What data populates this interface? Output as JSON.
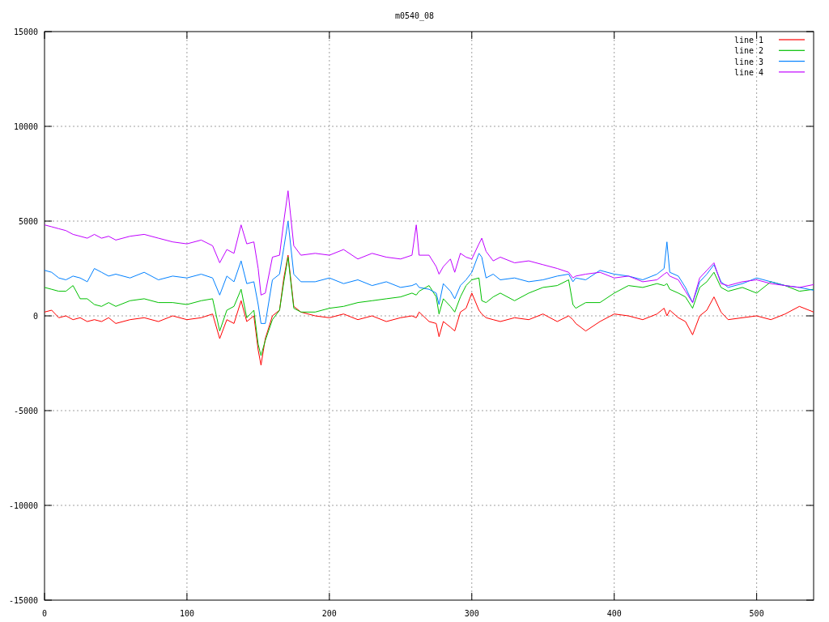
{
  "chart_data": {
    "type": "line",
    "title": "m0540_08",
    "grid": true,
    "legend": true,
    "xlim": [
      0,
      540
    ],
    "ylim": [
      -15000,
      15000
    ],
    "xticks": [
      0,
      100,
      200,
      300,
      400,
      500
    ],
    "yticks": [
      -15000,
      -10000,
      -5000,
      0,
      5000,
      10000,
      15000
    ],
    "x": [
      0,
      5,
      10,
      15,
      20,
      25,
      30,
      35,
      40,
      45,
      50,
      60,
      70,
      80,
      90,
      100,
      110,
      118,
      123,
      128,
      133,
      138,
      142,
      147,
      150,
      152,
      155,
      160,
      165,
      168,
      171,
      175,
      180,
      190,
      200,
      210,
      220,
      230,
      240,
      250,
      258,
      261,
      263,
      270,
      275,
      277,
      280,
      285,
      288,
      292,
      296,
      300,
      305,
      307,
      310,
      315,
      320,
      330,
      340,
      350,
      360,
      368,
      371,
      373,
      380,
      390,
      400,
      410,
      420,
      430,
      435,
      437,
      439,
      445,
      450,
      455,
      460,
      465,
      470,
      475,
      480,
      490,
      500,
      510,
      520,
      530,
      540
    ],
    "series": [
      {
        "name": "line 1",
        "color": "#ff0000",
        "values": [
          200,
          300,
          -100,
          0,
          -200,
          -100,
          -300,
          -200,
          -300,
          -100,
          -400,
          -200,
          -100,
          -300,
          0,
          -200,
          -100,
          100,
          -1200,
          -200,
          -400,
          800,
          -300,
          0,
          -1800,
          -2600,
          -1200,
          0,
          300,
          2000,
          3200,
          500,
          200,
          0,
          -100,
          100,
          -200,
          0,
          -300,
          -100,
          0,
          -100,
          200,
          -300,
          -400,
          -1100,
          -300,
          -600,
          -800,
          200,
          400,
          1200,
          300,
          100,
          -100,
          -200,
          -300,
          -100,
          -200,
          100,
          -300,
          0,
          -200,
          -400,
          -800,
          -300,
          100,
          0,
          -200,
          100,
          400,
          0,
          300,
          -100,
          -300,
          -1000,
          0,
          300,
          1000,
          200,
          -200,
          -100,
          0,
          -200,
          100,
          500,
          200
        ]
      },
      {
        "name": "line 2",
        "color": "#00c000",
        "values": [
          1500,
          1400,
          1300,
          1300,
          1600,
          900,
          900,
          600,
          500,
          700,
          500,
          800,
          900,
          700,
          700,
          600,
          800,
          900,
          -800,
          300,
          500,
          1400,
          -100,
          300,
          -1500,
          -2100,
          -1300,
          -200,
          300,
          1800,
          3100,
          400,
          200,
          200,
          400,
          500,
          700,
          800,
          900,
          1000,
          1200,
          1100,
          1300,
          1600,
          1000,
          100,
          900,
          500,
          200,
          1000,
          1600,
          1900,
          2000,
          800,
          700,
          1000,
          1200,
          800,
          1200,
          1500,
          1600,
          1900,
          600,
          400,
          700,
          700,
          1200,
          1600,
          1500,
          1700,
          1600,
          1700,
          1400,
          1200,
          1000,
          400,
          1500,
          1800,
          2300,
          1500,
          1300,
          1500,
          1200,
          1800,
          1600,
          1300,
          1400
        ]
      },
      {
        "name": "line 3",
        "color": "#0080ff",
        "values": [
          2400,
          2300,
          2000,
          1900,
          2100,
          2000,
          1800,
          2500,
          2300,
          2100,
          2200,
          2000,
          2300,
          1900,
          2100,
          2000,
          2200,
          2000,
          1100,
          2100,
          1800,
          2900,
          1700,
          1800,
          600,
          -400,
          -400,
          1900,
          2200,
          3600,
          5000,
          2200,
          1800,
          1800,
          2000,
          1700,
          1900,
          1600,
          1800,
          1500,
          1600,
          1700,
          1500,
          1400,
          1200,
          600,
          1700,
          1300,
          900,
          1600,
          1900,
          2300,
          3300,
          3100,
          2000,
          2200,
          1900,
          2000,
          1800,
          1900,
          2100,
          2200,
          1800,
          2000,
          1900,
          2400,
          2200,
          2100,
          1900,
          2200,
          2500,
          3900,
          2300,
          2100,
          1500,
          700,
          1800,
          2200,
          2700,
          1800,
          1500,
          1700,
          2000,
          1800,
          1600,
          1500,
          1350
        ]
      },
      {
        "name": "line 4",
        "color": "#c000ff",
        "values": [
          4800,
          4700,
          4600,
          4500,
          4300,
          4200,
          4100,
          4300,
          4100,
          4200,
          4000,
          4200,
          4300,
          4100,
          3900,
          3800,
          4000,
          3700,
          2800,
          3500,
          3300,
          4800,
          3800,
          3900,
          2500,
          1100,
          1200,
          3100,
          3200,
          5000,
          6600,
          3700,
          3200,
          3300,
          3200,
          3500,
          3000,
          3300,
          3100,
          3000,
          3200,
          4800,
          3200,
          3200,
          2600,
          2200,
          2600,
          3000,
          2300,
          3300,
          3100,
          3000,
          3800,
          4100,
          3400,
          2900,
          3100,
          2800,
          2900,
          2700,
          2500,
          2300,
          2000,
          2100,
          2200,
          2300,
          2000,
          2100,
          1800,
          1900,
          2200,
          2300,
          2100,
          1900,
          1300,
          700,
          2000,
          2400,
          2800,
          1700,
          1600,
          1800,
          1900,
          1700,
          1600,
          1500,
          1650
        ]
      }
    ]
  }
}
